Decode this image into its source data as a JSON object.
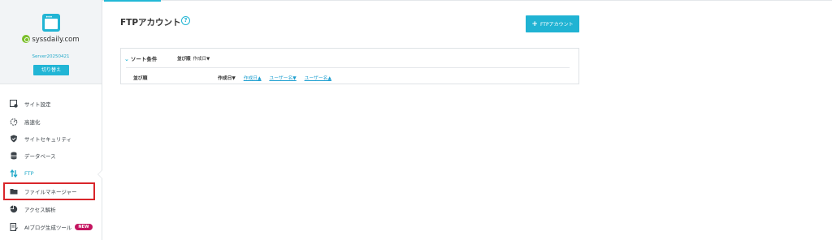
{
  "site": {
    "domain": "syssdaily.com",
    "server_id": "Server20250421",
    "switch_label": "切り替え"
  },
  "nav": {
    "items": [
      {
        "label": "サイト設定",
        "icon": "site-settings-icon"
      },
      {
        "label": "高速化",
        "icon": "speed-icon"
      },
      {
        "label": "サイトセキュリティ",
        "icon": "shield-icon"
      },
      {
        "label": "データベース",
        "icon": "database-icon"
      },
      {
        "label": "FTP",
        "icon": "ftp-icon",
        "active": true
      },
      {
        "label": "ファイルマネージャー",
        "icon": "folder-icon"
      },
      {
        "label": "アクセス解析",
        "icon": "pie-chart-icon"
      },
      {
        "label": "AIブログ生成ツール",
        "icon": "ai-doc-icon",
        "badge": "NEW"
      }
    ]
  },
  "main": {
    "title": "FTPアカウント",
    "help_glyph": "?",
    "add_button_label": "FTPアカウント",
    "add_button_glyph": "+"
  },
  "sort": {
    "heading": "ソート条件",
    "current_key": "並び順",
    "current_value": "作成日▼",
    "order_label": "並び順",
    "options": [
      {
        "label": "作成日▼",
        "current": true
      },
      {
        "label": "作成日▲",
        "current": false
      },
      {
        "label": "ユーザー名▼",
        "current": false
      },
      {
        "label": "ユーザー名▲",
        "current": false
      }
    ]
  },
  "colors": {
    "accent": "#21b5d5",
    "highlight_border": "#d9252a",
    "new_badge": "#c41460",
    "link": "#1e9fd0"
  }
}
